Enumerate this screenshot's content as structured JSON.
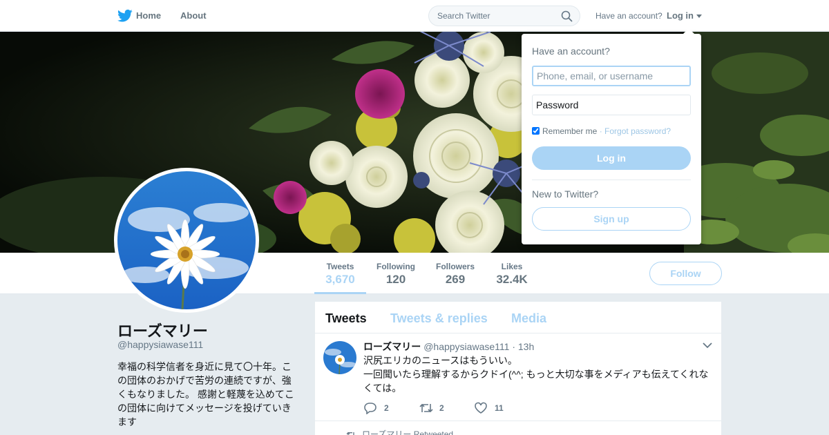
{
  "nav": {
    "logo_icon": "twitter-bird-icon",
    "home": "Home",
    "about": "About",
    "search_placeholder": "Search Twitter",
    "have_account": "Have an account?",
    "login": "Log in",
    "brand_color": "#1da1f2"
  },
  "profile": {
    "display_name": "ローズマリー",
    "screen_name": "@happysiawase111",
    "bio": "幸福の科学信者を身近に見て〇十年。この団体のおかげで苦労の連続ですが、強くもなりました。 感謝と軽蔑を込めてこの団体に向けてメッセージを投げていきます"
  },
  "stats": [
    {
      "label": "Tweets",
      "value": "3,670"
    },
    {
      "label": "Following",
      "value": "120"
    },
    {
      "label": "Followers",
      "value": "269"
    },
    {
      "label": "Likes",
      "value": "32.4K"
    }
  ],
  "follow_label": "Follow",
  "timeline": {
    "tabs": [
      "Tweets",
      "Tweets & replies",
      "Media"
    ],
    "tweet": {
      "name": "ローズマリー",
      "handle": "@happysiawase111",
      "separator": "·",
      "time": "13h",
      "line1": "沢尻エリカのニュースはもういい。",
      "line2": "一回聞いたら理解するからクドイ(^^; もっと大切な事をメディアも伝えてくれなくては。",
      "replies": "2",
      "retweets": "2",
      "likes": "11"
    },
    "retweet_context": "ローズマリー Retweeted"
  },
  "login_dropdown": {
    "title": "Have an account?",
    "username_placeholder": "Phone, email, or username",
    "password_placeholder": "Password",
    "remember": "Remember me",
    "separator": "·",
    "forgot": "Forgot password?",
    "login_button": "Log in",
    "new_to": "New to Twitter?",
    "signup_button": "Sign up"
  },
  "colors": {
    "accent_light": "#aad4f5",
    "muted_text": "#657786",
    "page_bg": "#e6ecf0"
  }
}
